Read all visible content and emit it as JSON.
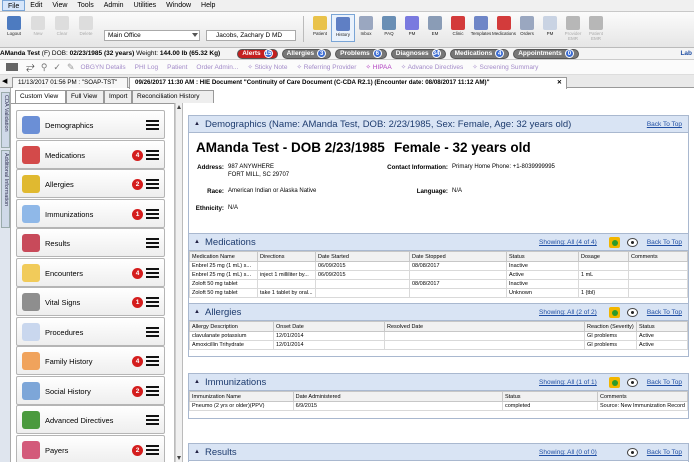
{
  "menu": [
    "File",
    "Edit",
    "View",
    "Tools",
    "Admin",
    "Utilities",
    "Window",
    "Help"
  ],
  "toolbar": {
    "logout": "Logout",
    "new": "New",
    "clear": "Clear",
    "delete": "Delete",
    "office": "Main Office",
    "provider": "Jacobs, Zachary D MD",
    "right_buttons": [
      "Patient",
      "History",
      "Inbox",
      "PAQ",
      "PM",
      "EM",
      "Clinic",
      "Templates",
      "Medications",
      "Orders",
      "PM",
      "Provider EMR",
      "Patient EMR"
    ]
  },
  "patient": {
    "name": "AManda Test",
    "sex": "(F)",
    "dob_label": "DOB:",
    "dob": "02/23/1985 (32 years)",
    "weight_label": "Weight:",
    "weight": "144.00 lb (65.32 Kg)",
    "pills": [
      {
        "label": "Alerts",
        "count": "15",
        "color": "red"
      },
      {
        "label": "Allergies",
        "count": "3",
        "color": "gray"
      },
      {
        "label": "Problems",
        "count": "6",
        "color": "gray"
      },
      {
        "label": "Diagnoses",
        "count": "34",
        "color": "gray"
      },
      {
        "label": "Medications",
        "count": "4",
        "color": "gray"
      },
      {
        "label": "Appointments",
        "count": "0",
        "color": "gray"
      }
    ],
    "lab": "Lab"
  },
  "linkbar": [
    "OBGYN Details",
    "PHI Log",
    "Patient",
    "Order Admin...",
    "✧ Sticky Note",
    "✧ Referring Provider",
    "✧ HIPAA",
    "✧ Advance Directives",
    "✧ Screening Summary"
  ],
  "doctabs": [
    "11/13/2017 01:56 PM : \"SOAP-TST\"",
    "09/26/2017 11:30 AM : HIE Document \"Continuity of Care Document (C-CDA R2.1) (Encounter date: 08/08/2017 11:12 AM)\""
  ],
  "vtabs": [
    "CDA Validation",
    "Additional Information"
  ],
  "subtabs": [
    "Custom View",
    "Full View",
    "Import",
    "Reconciliation History"
  ],
  "sections": [
    {
      "label": "Demographics",
      "badge": "",
      "color": "#6b8fd6"
    },
    {
      "label": "Medications",
      "badge": "4",
      "color": "#d34a4a"
    },
    {
      "label": "Allergies",
      "badge": "2",
      "color": "#e0b930"
    },
    {
      "label": "Immunizations",
      "badge": "1",
      "color": "#8fb8e8"
    },
    {
      "label": "Results",
      "badge": "",
      "color": "#c84a5a"
    },
    {
      "label": "Encounters",
      "badge": "4",
      "color": "#f1cb5a"
    },
    {
      "label": "Vital Signs",
      "badge": "1",
      "color": "#8e8e8e"
    },
    {
      "label": "Procedures",
      "badge": "",
      "color": "#c9d7ee"
    },
    {
      "label": "Family History",
      "badge": "4",
      "color": "#f0a35c"
    },
    {
      "label": "Social History",
      "badge": "2",
      "color": "#7da6d8"
    },
    {
      "label": "Advanced Directives",
      "badge": "",
      "color": "#4b9a3e"
    },
    {
      "label": "Payers",
      "badge": "2",
      "color": "#d35a7a"
    }
  ],
  "demographics": {
    "header": "Demographics (Name: AManda Test, DOB: 2/23/1985, Sex: Female, Age: 32 years old)",
    "back": "Back To Top",
    "title_left": "AManda Test - DOB 2/23/1985",
    "title_right": "Female - 32 years old",
    "address_label": "Address:",
    "address1": "987 ANYWHERE",
    "address2": "FORT MILL, SC 29707",
    "contact_label": "Contact Information:",
    "contact": "Primary Home Phone: +1-8039999995",
    "race_label": "Race:",
    "race": "American Indian or Alaska Native",
    "lang_label": "Language:",
    "lang": "N/A",
    "eth_label": "Ethnicity:",
    "eth": "N/A"
  },
  "medications": {
    "header": "Medications",
    "showing": "Showing: All (4 of 4)",
    "back": "Back To Top",
    "columns": [
      "Medication Name",
      "Directions",
      "Date Started",
      "Date Stopped",
      "Status",
      "Dosage",
      "Comments"
    ],
    "rows": [
      [
        "Enbrel 25 mg (1 mL) s...",
        "",
        "06/09/2015",
        "08/08/2017",
        "Inactive",
        "",
        ""
      ],
      [
        "Enbrel 25 mg (1 mL) s...",
        "inject 1 milliliter by...",
        "06/09/2015",
        "",
        "Active",
        "1 mL",
        ""
      ],
      [
        "Zoloft 50 mg tablet",
        "",
        "",
        "08/08/2017",
        "Inactive",
        "",
        ""
      ],
      [
        "Zoloft 50 mg tablet",
        "take 1 tablet by oral...",
        "",
        "",
        "Unknown",
        "1 {tbl}",
        ""
      ]
    ]
  },
  "allergies": {
    "header": "Allergies",
    "showing": "Showing: All (2 of 2)",
    "back": "Back To Top",
    "columns": [
      "Allergy Description",
      "Onset Date",
      "Resolved Date",
      "Reaction (Severity)",
      "Status"
    ],
    "rows": [
      [
        "clavulanate potassium",
        "12/01/2014",
        "",
        "GI problems",
        "Active"
      ],
      [
        "Amoxicillin Trihydrate",
        "12/01/2014",
        "",
        "GI problems",
        "Active"
      ]
    ]
  },
  "immunizations": {
    "header": "Immunizations",
    "showing": "Showing: All (1 of 1)",
    "back": "Back To Top",
    "columns": [
      "Immunization Name",
      "Date Administered",
      "Status",
      "Comments"
    ],
    "rows": [
      [
        "Pneumo (2 yrs or older)(PPV)",
        "6/9/2015",
        "completed",
        "Source: New Immunization Record"
      ]
    ]
  },
  "results": {
    "header": "Results",
    "showing": "Showing: All (0 of 0)",
    "back": "Back To Top"
  }
}
